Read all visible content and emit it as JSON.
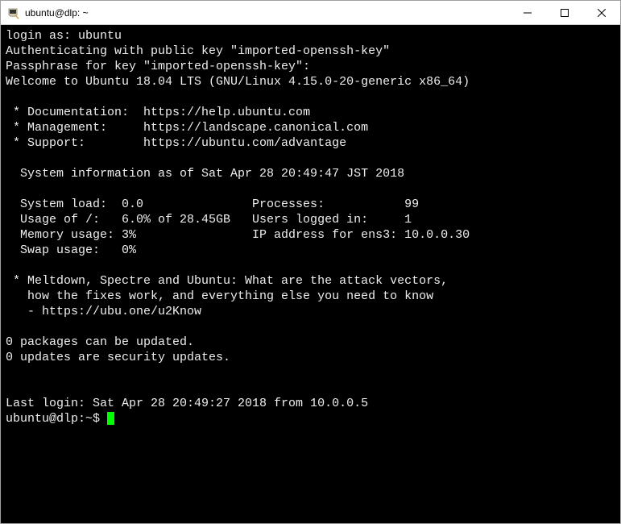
{
  "window": {
    "title": "ubuntu@dlp: ~"
  },
  "terminal": {
    "login_prompt": "login as: ",
    "login_user": "ubuntu",
    "auth_line": "Authenticating with public key \"imported-openssh-key\"",
    "passphrase_line": "Passphrase for key \"imported-openssh-key\":",
    "welcome_line": "Welcome to Ubuntu 18.04 LTS (GNU/Linux 4.15.0-20-generic x86_64)",
    "doc_label": " * Documentation:  ",
    "doc_url": "https://help.ubuntu.com",
    "mgmt_label": " * Management:     ",
    "mgmt_url": "https://landscape.canonical.com",
    "support_label": " * Support:        ",
    "support_url": "https://ubuntu.com/advantage",
    "sysinfo_header": "  System information as of Sat Apr 28 20:49:47 JST 2018",
    "row1": "  System load:  0.0               Processes:           99",
    "row2": "  Usage of /:   6.0% of 28.45GB   Users logged in:     1",
    "row3": "  Memory usage: 3%                IP address for ens3: 10.0.0.30",
    "row4": "  Swap usage:   0%",
    "meltdown1": " * Meltdown, Spectre and Ubuntu: What are the attack vectors,",
    "meltdown2": "   how the fixes work, and everything else you need to know",
    "meltdown3": "   - https://ubu.one/u2Know",
    "updates1": "0 packages can be updated.",
    "updates2": "0 updates are security updates.",
    "lastlogin": "Last login: Sat Apr 28 20:49:27 2018 from 10.0.0.5",
    "prompt": "ubuntu@dlp:~$ "
  }
}
